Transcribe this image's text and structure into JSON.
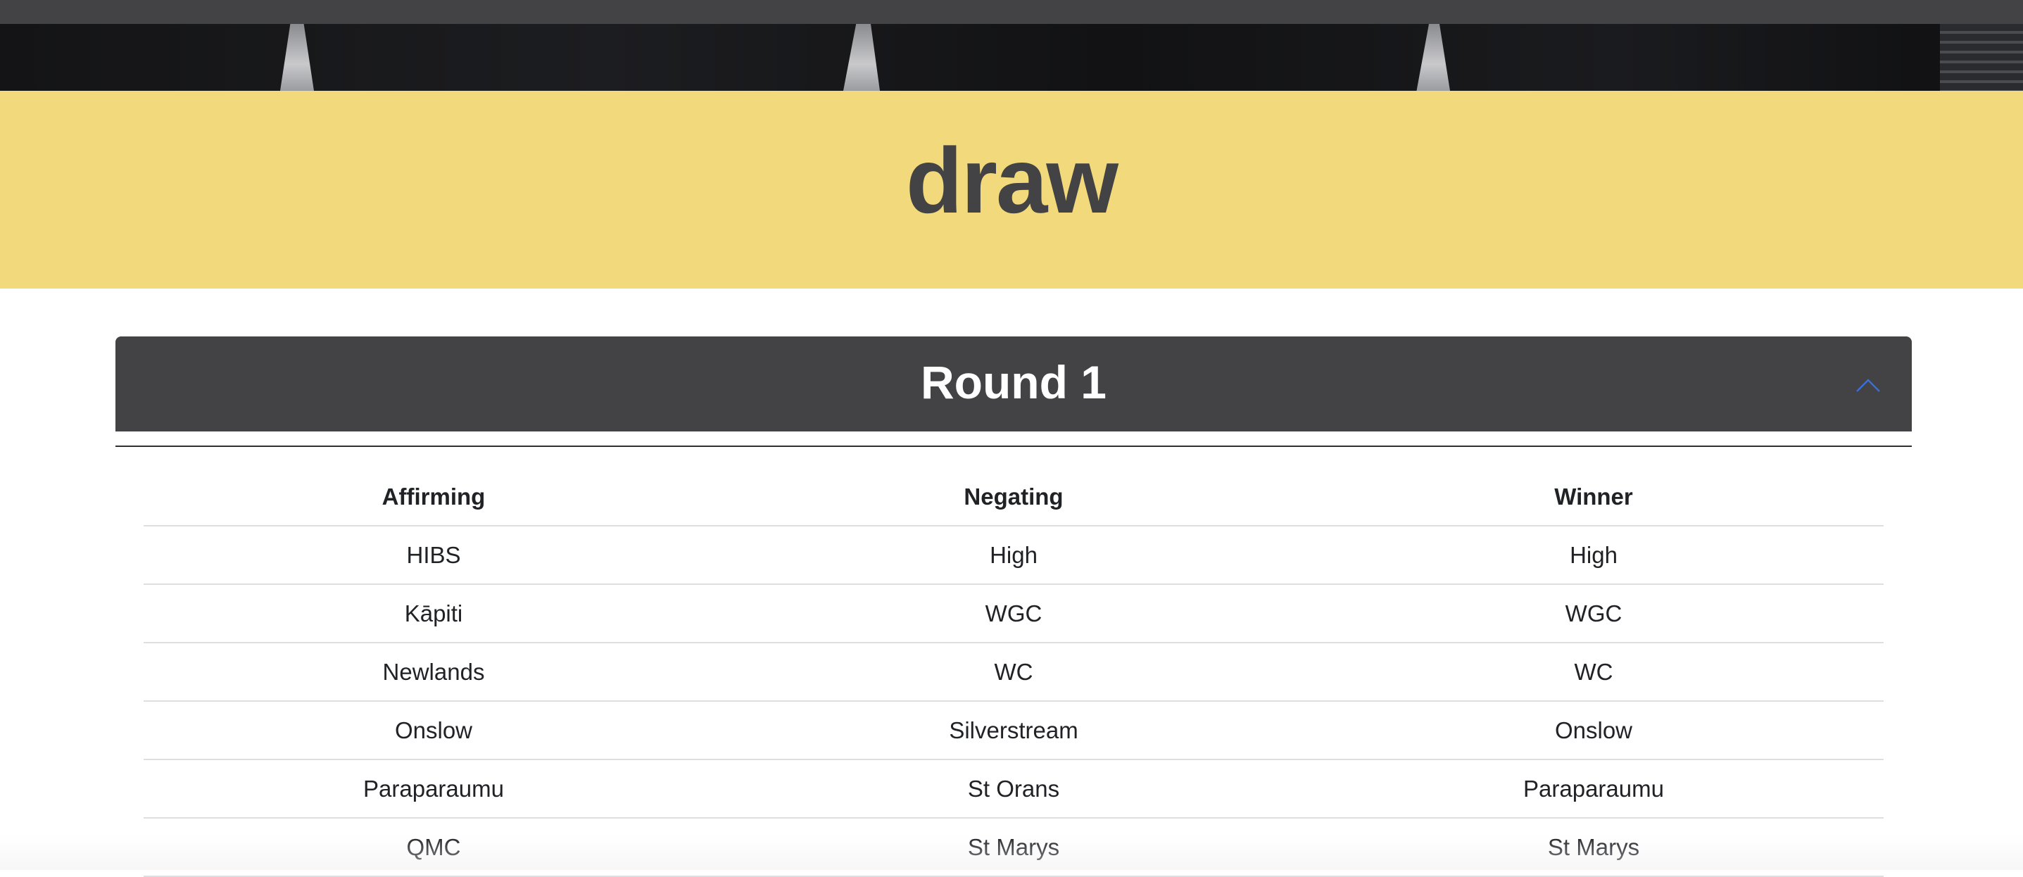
{
  "page": {
    "title": "draw"
  },
  "round": {
    "title": "Round 1",
    "collapse_icon": "chevron-up-icon",
    "expanded": true
  },
  "table": {
    "columns": [
      "Affirming",
      "Negating",
      "Winner"
    ],
    "rows": [
      [
        "HIBS",
        "High",
        "High"
      ],
      [
        "Kāpiti",
        "WGC",
        "WGC"
      ],
      [
        "Newlands",
        "WC",
        "WC"
      ],
      [
        "Onslow",
        "Silverstream",
        "Onslow"
      ],
      [
        "Paraparaumu",
        "St Orans",
        "Paraparaumu"
      ],
      [
        "QMC",
        "St Marys",
        "St Marys"
      ]
    ]
  },
  "colors": {
    "title_band": "#f2d97c",
    "dark": "#434244",
    "accent": "#3a6fd8"
  }
}
